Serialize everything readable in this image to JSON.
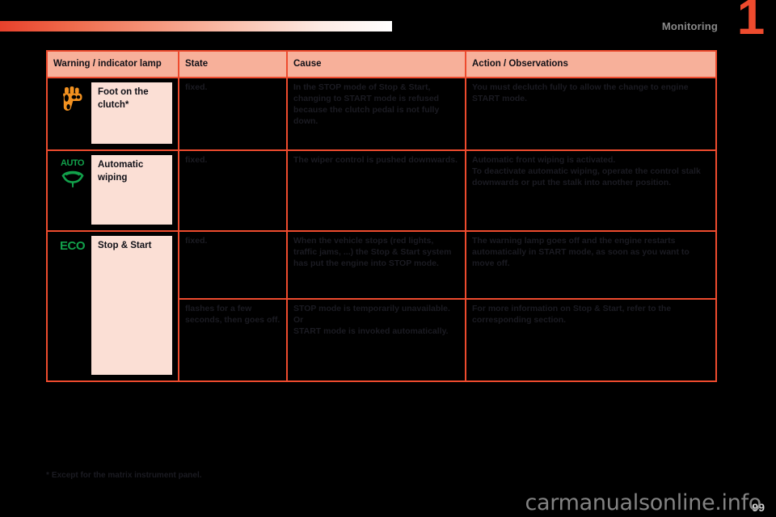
{
  "header": {
    "chapter_title": "Monitoring",
    "chapter_number": "1",
    "accent_color": "#ee4b2e",
    "header_bg_color": "#f7b09a"
  },
  "table": {
    "columns": [
      "Warning / indicator lamp",
      "State",
      "Cause",
      "Action / Observations"
    ],
    "rows": [
      {
        "icon": "foot-on-clutch-icon",
        "icon_color": "#f29120",
        "lamp": "Foot on the clutch*",
        "state": "fixed.",
        "cause": "In the STOP mode of Stop & Start, changing to START mode is refused because the clutch pedal is not fully down.",
        "action": "You must declutch fully to allow the change to engine START mode."
      },
      {
        "icon": "automatic-wiping-icon",
        "icon_color": "#12a14b",
        "icon_text": "AUTO",
        "lamp": "Automatic wiping",
        "state": "fixed.",
        "cause": "The wiper control is pushed downwards.",
        "action": "Automatic front wiping is activated.\nTo deactivate automatic wiping, operate the control stalk downwards or put the stalk into another position."
      },
      {
        "icon": "eco-icon",
        "icon_color": "#12a14b",
        "icon_text": "ECO",
        "lamp": "Stop & Start",
        "state": "fixed.",
        "cause": "When the vehicle stops (red lights, traffic jams, ...) the Stop & Start system has put the engine into STOP mode.",
        "action": "The warning lamp goes off and the engine restarts automatically in START mode, as soon as you want to move off."
      },
      {
        "icon": null,
        "lamp": null,
        "state": "flashes for a few seconds, then goes off.",
        "cause": "STOP mode is temporarily unavailable.\nOr\nSTART mode is invoked automatically.",
        "action": "For more information on Stop & Start, refer to the corresponding section."
      }
    ]
  },
  "footnote": {
    "marker": "*",
    "text": "Except for the matrix instrument panel."
  },
  "footer": {
    "page_number": "99",
    "watermark": "carmanualsonline.info"
  }
}
